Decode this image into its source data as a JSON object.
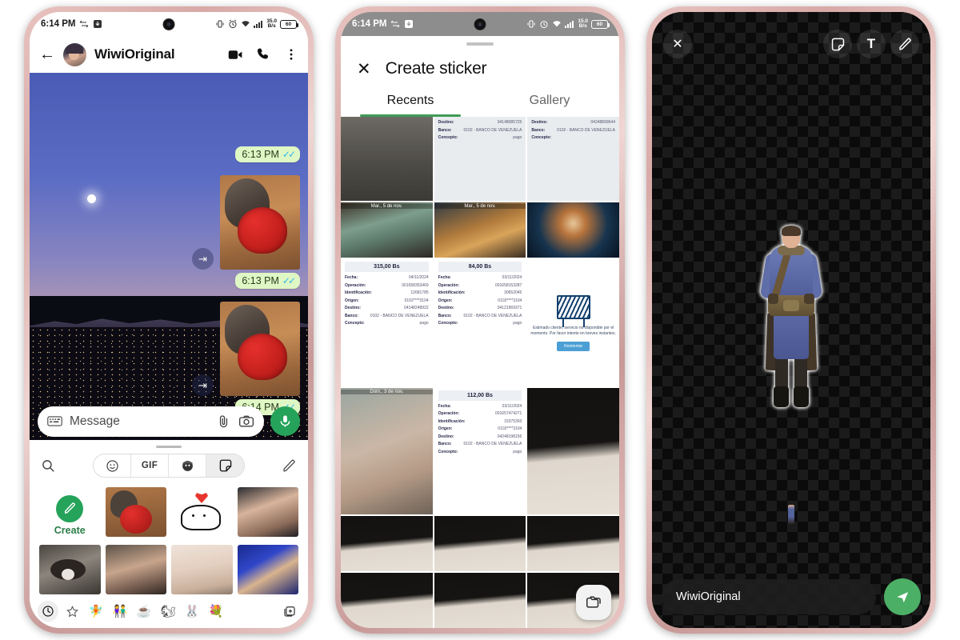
{
  "phone1": {
    "status": {
      "time": "6:14 PM",
      "netspeed_value": "35.0",
      "netspeed_unit": "B/s",
      "battery": "60",
      "icons": [
        "sync-icon",
        "download-icon",
        "vibrate-icon",
        "alarm-icon",
        "wifi-icon",
        "signal-icon",
        "battery-icon"
      ]
    },
    "header": {
      "back": "back-arrow-icon",
      "contact_name": "WiwiOriginal",
      "video_call": "video-call-icon",
      "voice_call": "phone-icon",
      "menu": "more-vertical-icon"
    },
    "messages": [
      {
        "time": "6:13 PM",
        "status_ticks": "read",
        "kind": "time-only"
      },
      {
        "time": "6:13 PM",
        "status_ticks": "read",
        "kind": "sticker",
        "sticker_alt": "otter hugging red knitted heart",
        "forwarded": true
      },
      {
        "time": "6:14 PM",
        "status_ticks": "read",
        "kind": "sticker",
        "sticker_alt": "otter hugging red knitted heart",
        "forwarded": true
      }
    ],
    "input": {
      "placeholder": "Message",
      "keyboard_icon": "keyboard-icon",
      "attach_icon": "paperclip-icon",
      "camera_icon": "camera-icon",
      "mic_icon": "microphone-icon"
    },
    "tray": {
      "search_icon": "search-icon",
      "edit_icon": "pencil-icon",
      "segments": [
        {
          "name": "emoji-icon",
          "label": "",
          "active": false
        },
        {
          "name": "gif-tab",
          "label": "GIF",
          "active": false
        },
        {
          "name": "avatar-icon",
          "label": "",
          "active": false
        },
        {
          "name": "sticker-icon",
          "label": "",
          "active": true
        }
      ],
      "create": {
        "label": "Create",
        "icon": "pencil-icon"
      },
      "stickers": [
        "otter-with-red-heart",
        "white-cat-drawing-holding-heart",
        "woman-annoyed-face",
        "raccoon-close-up",
        "older-woman-serious-face",
        "young-woman-crying",
        "cartoon-man-blue-background"
      ],
      "bottom_icons": [
        {
          "name": "recent-clock-icon",
          "glyph": "\u0000",
          "active": true
        },
        {
          "name": "favorites-star-icon",
          "glyph": "☆",
          "active": false
        },
        {
          "name": "sticker-pack-fairy",
          "glyph": "🧚",
          "active": false
        },
        {
          "name": "sticker-pack-couple",
          "glyph": "👫",
          "active": false
        },
        {
          "name": "sticker-pack-coffee",
          "glyph": "☕",
          "active": false
        },
        {
          "name": "sticker-pack-add-1",
          "glyph": "🐿",
          "active": false
        },
        {
          "name": "sticker-pack-add-2",
          "glyph": "🐰",
          "active": false
        },
        {
          "name": "sticker-pack-flower",
          "glyph": "💐",
          "active": false
        },
        {
          "name": "add-sticker-pack-icon",
          "glyph": "",
          "active": false
        }
      ]
    }
  },
  "phone2": {
    "status": {
      "time": "6:14 PM",
      "netspeed_value": "15.0",
      "netspeed_unit": "B/s",
      "battery": "60"
    },
    "sheet": {
      "close_icon": "close-x-icon",
      "title": "Create sticker"
    },
    "tabs": [
      {
        "label": "Recents",
        "active": true
      },
      {
        "label": "Gallery",
        "active": false
      }
    ],
    "gallery": [
      {
        "type": "photo",
        "style": "p-road",
        "alt": "gravel road surface",
        "label": ""
      },
      {
        "type": "receipt-head",
        "alt": "bank transfer receipt top",
        "lines": [
          {
            "k": "Destino:",
            "v": "04148085725"
          },
          {
            "k": "Banco:",
            "v": "0102 - BANCO DE VENEZUELA"
          },
          {
            "k": "Concepto:",
            "v": "pago"
          }
        ]
      },
      {
        "type": "receipt-head",
        "alt": "bank transfer receipt top",
        "lines": [
          {
            "k": "Destino:",
            "v": "04248899644"
          },
          {
            "k": "Banco:",
            "v": "0102 - BANCO DE VENEZUELA"
          },
          {
            "k": "Concepto:",
            "v": ""
          }
        ]
      },
      {
        "type": "photo",
        "style": "p-cake",
        "alt": "green mugs and slice of cake",
        "label": "Mar., 5 de nov."
      },
      {
        "type": "photo",
        "style": "p-uku",
        "alt": "ukulele on autumn leaves",
        "label": "Mar., 5 de nov."
      },
      {
        "type": "photo",
        "style": "p-jelly",
        "alt": "jellyfish in dark water",
        "label": ""
      },
      {
        "type": "receipt",
        "amount": "315,00 Bs",
        "lines": [
          {
            "k": "Fecha:",
            "v": "04/11/2024"
          },
          {
            "k": "Operación:",
            "v": "001658353469"
          },
          {
            "k": "Identificación:",
            "v": "12681785"
          },
          {
            "k": "Origen:",
            "v": "0102****3104"
          },
          {
            "k": "Destino:",
            "v": "04148248922"
          },
          {
            "k": "Banco:",
            "v": "0102 - BANCO DE VENEZUELA"
          },
          {
            "k": "Concepto:",
            "v": "pago"
          }
        ]
      },
      {
        "type": "receipt",
        "amount": "84,00 Bs",
        "lines": [
          {
            "k": "Fecha:",
            "v": "03/11/2024"
          },
          {
            "k": "Operación:",
            "v": "001658153287"
          },
          {
            "k": "Identificación:",
            "v": "30652045"
          },
          {
            "k": "Origen:",
            "v": "0102****3104"
          },
          {
            "k": "Destino:",
            "v": "04121969371"
          },
          {
            "k": "Banco:",
            "v": "0102 - BANCO DE VENEZUELA"
          },
          {
            "k": "Concepto:",
            "v": "pago"
          }
        ]
      },
      {
        "type": "maintenance",
        "text": "Estimado cliente, servicio no disponible por el momento. Por favor intente en breves instantes.",
        "button": "Reintentar"
      },
      {
        "type": "photo",
        "style": "p-chair",
        "alt": "beige upholstered armchair",
        "label": "Dom., 3 de nov."
      },
      {
        "type": "receipt",
        "amount": "112,00 Bs",
        "lines": [
          {
            "k": "Fecha:",
            "v": "03/11/2024"
          },
          {
            "k": "Operación:",
            "v": "001657474271"
          },
          {
            "k": "Identificación:",
            "v": "15375393"
          },
          {
            "k": "Origen:",
            "v": "0102****3104"
          },
          {
            "k": "Destino:",
            "v": "04248198156"
          },
          {
            "k": "Banco:",
            "v": "0102 - BANCO DE VENEZUELA"
          },
          {
            "k": "Concepto:",
            "v": "pago"
          }
        ]
      },
      {
        "type": "photo",
        "style": "p-shadow",
        "alt": "shadow of tree on sandy ground",
        "label": ""
      },
      {
        "type": "photo",
        "style": "p-shadow",
        "alt": "shadow of tree on sandy ground",
        "label": ""
      },
      {
        "type": "photo",
        "style": "p-shadow",
        "alt": "shadow of tree on sandy ground",
        "label": ""
      },
      {
        "type": "photo",
        "style": "p-shadow",
        "alt": "shadow of tree on sandy ground",
        "label": ""
      },
      {
        "type": "photo",
        "style": "p-shadow",
        "alt": "shadow of tree on sandy ground",
        "label": ""
      },
      {
        "type": "photo",
        "style": "p-shadow",
        "alt": "shadow of tree on sandy ground",
        "label": ""
      },
      {
        "type": "photo",
        "style": "p-shadow",
        "alt": "shadow of tree on sandy ground",
        "label": ""
      }
    ],
    "fab": {
      "icon": "folder-picker-icon"
    }
  },
  "phone3": {
    "toolbar": {
      "close_icon": "close-x-icon",
      "sticker_icon": "sticker-icon",
      "text_icon": "text-tool-icon",
      "draw_icon": "pencil-draw-icon"
    },
    "canvas": {
      "background": "transparent-checkerboard",
      "sticker_alt": "game character in blue tunic with leather belt and boots"
    },
    "recipient": "WiwiOriginal",
    "send": {
      "icon": "send-icon"
    },
    "colors": {
      "accent_green": "#4caf66",
      "canvas_dark": "#1b1b1b"
    }
  },
  "theme": {
    "whatsapp_green": "#25a35a",
    "tick_blue": "#34b7f1",
    "bubble_green": "#dff7c4",
    "tab_underline": "#3f9b56",
    "phone_frame": "#d8a9a6"
  }
}
